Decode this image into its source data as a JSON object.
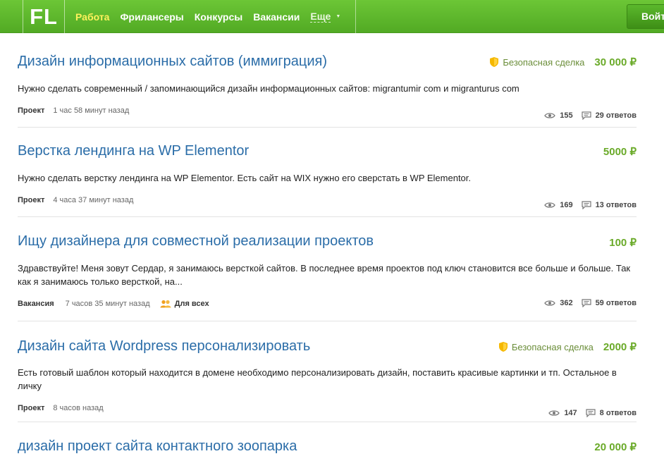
{
  "header": {
    "logo": "FL",
    "nav": [
      {
        "label": "Работа"
      },
      {
        "label": "Фрилансеры"
      },
      {
        "label": "Конкурсы"
      },
      {
        "label": "Вакансии"
      }
    ],
    "more_label": "Еще",
    "login_label": "Войт"
  },
  "colors": {
    "header_green": "#5cb82c",
    "active_nav": "#fff25c",
    "title_link": "#2b6da8",
    "price_green": "#6aaa29",
    "shield_yellow": "#f5b800"
  },
  "icons": {
    "safe_deal": "shield-icon",
    "views": "eye-icon",
    "answers": "speech-bubble-icon",
    "audience": "people-icon"
  },
  "projects": [
    {
      "title": "Дизайн информационных сайтов (иммиграция)",
      "safe_deal": "Безопасная сделка",
      "price": "30 000 ₽",
      "description": "Нужно сделать современный / запоминающийся дизайн информационных сайтов: migrantumir com и migranturus com",
      "type": "Проект",
      "time": "1 час 58 минут назад",
      "views": "155",
      "answers": "29 ответов"
    },
    {
      "title": "Верстка лендинга на WP Elementor",
      "price": "5000 ₽",
      "description": "Нужно сделать верстку лендинга на WP Elementor. Есть сайт на WIX нужно его сверстать в WP Elementor.",
      "type": "Проект",
      "time": "4 часа 37 минут назад",
      "views": "169",
      "answers": "13 ответов"
    },
    {
      "title": "Ищу дизайнера для совместной реализации проектов",
      "price": "100 ₽",
      "description": "Здравствуйте! Меня зовут Сердар, я занимаюсь версткой сайтов. В последнее время проектов под ключ становится все больше и больше.  Так как я занимаюсь только версткой, на...",
      "type": "Вакансия",
      "time": "7 часов 35 минут назад",
      "audience": "Для всех",
      "views": "362",
      "answers": "59 ответов"
    },
    {
      "title": "Дизайн сайта Wordpress персонализировать",
      "safe_deal": "Безопасная сделка",
      "price": "2000 ₽",
      "description": "Есть готовый шаблон который находится в домене необходимо персонализировать дизайн, поставить красивые картинки и тп. Остальное в личку",
      "type": "Проект",
      "time": "8 часов назад",
      "views": "147",
      "answers": "8 ответов"
    },
    {
      "title": "дизайн проект сайта контактного зоопарка",
      "price": "20 000 ₽"
    }
  ]
}
